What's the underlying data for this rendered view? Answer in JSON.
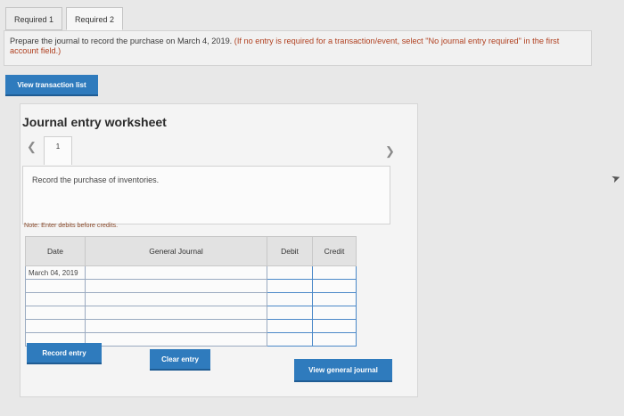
{
  "tabs": [
    {
      "label": "Required 1",
      "active": false
    },
    {
      "label": "Required 2",
      "active": true
    }
  ],
  "instructions": {
    "main": "Prepare the journal to record the purchase on March 4, 2019.",
    "hint": " (If no entry is required for a transaction/event, select \"No journal entry required\" in the first account field.)"
  },
  "buttons": {
    "view_transaction_list": "View transaction list",
    "record_entry": "Record entry",
    "clear_entry": "Clear entry",
    "view_general_journal": "View general journal"
  },
  "worksheet": {
    "title": "Journal entry worksheet",
    "prev_icon": "chevron-left-icon",
    "next_icon": "chevron-right-icon",
    "current_step": "1",
    "task": "Record the purchase of inventories.",
    "note": "Note: Enter debits before credits.",
    "table": {
      "headers": {
        "date": "Date",
        "general_journal": "General Journal",
        "debit": "Debit",
        "credit": "Credit"
      },
      "rows": [
        {
          "date": "March 04, 2019"
        },
        {
          "date": ""
        },
        {
          "date": ""
        },
        {
          "date": ""
        },
        {
          "date": ""
        },
        {
          "date": ""
        }
      ]
    }
  },
  "colors": {
    "button_blue": "#2f7bbd",
    "input_border_blue": "#4a88c8"
  }
}
